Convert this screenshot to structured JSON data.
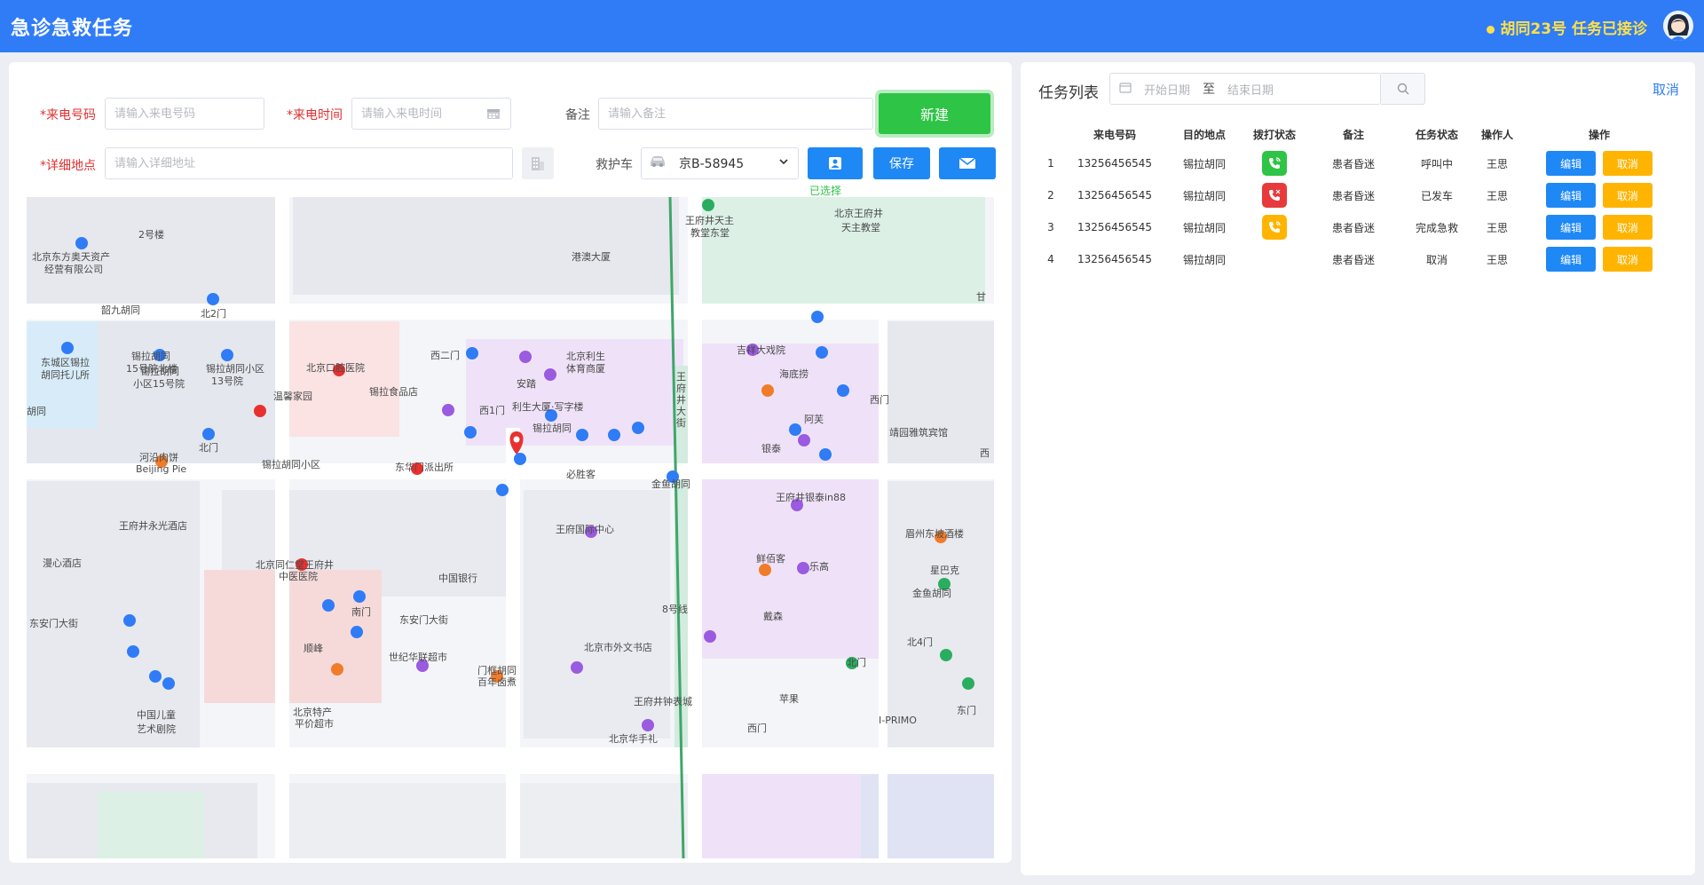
{
  "header": {
    "title": "急诊急救任务",
    "status": "胡同23号 任务已接诊"
  },
  "form": {
    "phone_label": "来电号码",
    "phone_placeholder": "请输入来电号码",
    "time_label": "来电时间",
    "time_placeholder": "请输入来电时间",
    "remark_label": "备注",
    "remark_placeholder": "请输入备注",
    "new_button": "新建",
    "address_label": "详细地点",
    "address_placeholder": "请输入详细地址",
    "ambulance_label": "救护车",
    "ambulance_value": "京B-58945",
    "save_button": "保存",
    "selected_hint": "已选择",
    "required_mark": "*"
  },
  "map": {
    "labels": {
      "l1": "2号楼",
      "l2": "北京东方奥天资产",
      "l3": "经营有限公司",
      "l4": "韶九胡同",
      "l5": "北2门",
      "l6": "锡拉胡同",
      "l7": "15号院北楼",
      "l8": "东城区锡拉",
      "l9": "胡同托儿所",
      "l10": "锡拉胡同",
      "l11": "小区15号院",
      "l12": "锡拉胡同小区",
      "l13": "13号院",
      "l14": "北京口腔医院",
      "l15": "温馨家园",
      "l16": "西二门",
      "l17": "安踏",
      "l18": "北京利生",
      "l19": "体育商厦",
      "l20": "锡拉食品店",
      "l21": "利生大厦·写字楼",
      "l22": "西1门",
      "l23": "胡同",
      "l24": "锡拉胡同",
      "l25": "王府井天主",
      "l26": "教堂东堂",
      "l27": "北京王府井",
      "l28": "天主教堂",
      "l29": "港澳大厦",
      "l30": "甘",
      "l31": "吉祥大戏院",
      "l32": "海底捞",
      "l33": "西门",
      "l34": "阿芙",
      "l35": "靖园雅筑宾馆",
      "l36": "银泰",
      "l37": "西",
      "l38": "王府井银泰in88",
      "l39": "眉州东坡酒楼",
      "l40": "星巴克",
      "l41": "鲜佰客",
      "l42": "乐高",
      "l43": "河沿肉饼",
      "l44": "Beijing Pie",
      "l45": "北门",
      "l46": "锡拉胡同小区",
      "l47": "东华门派出所",
      "l48": "必胜客",
      "l49": "王府国际中心",
      "l50": "金鱼胡同",
      "l51": "王府井永光酒店",
      "l52": "漫心酒店",
      "l53": "北京同仁堂王府井",
      "l54": "中医医院",
      "l55": "中国银行",
      "l56": "南门",
      "l57": "东安门大街",
      "l58": "东安门大街",
      "l59": "金鱼胡同",
      "l60": "戴森",
      "l61": "北4门",
      "l62": "北门",
      "l63": "苹果",
      "l64": "I-PRIMO",
      "l65": "东门",
      "l66": "西门",
      "l67": "顺峰",
      "l68": "世纪华联超市",
      "l69": "北京市外文书店",
      "l70": "门框胡同",
      "l71": "百年卤煮",
      "l72": "王府井钟表城",
      "l73": "北京特产",
      "l74": "平价超市",
      "l75": "中国儿童",
      "l76": "艺术剧院",
      "l77": "北京华手礼",
      "l78": "王",
      "l79": "府",
      "l80": "井",
      "l81": "大",
      "l82": "街",
      "l83": "8号线"
    }
  },
  "task_list": {
    "title": "任务列表",
    "start_placeholder": "开始日期",
    "separator": "至",
    "end_placeholder": "结束日期",
    "cancel": "取消",
    "columns": [
      "",
      "来电号码",
      "目的地点",
      "拨打状态",
      "备注",
      "任务状态",
      "操作人",
      "操作"
    ],
    "rows": [
      {
        "index": "1",
        "phone": "13256456545",
        "dest": "锡拉胡同",
        "call": "green",
        "remark": "患者昏迷",
        "status": "呼叫中",
        "operator": "王思",
        "edit": "编辑",
        "cancel": "取消"
      },
      {
        "index": "2",
        "phone": "13256456545",
        "dest": "锡拉胡同",
        "call": "red",
        "remark": "患者昏迷",
        "status": "已发车",
        "operator": "王思",
        "edit": "编辑",
        "cancel": "取消"
      },
      {
        "index": "3",
        "phone": "13256456545",
        "dest": "锡拉胡同",
        "call": "yellow",
        "remark": "患者昏迷",
        "status": "完成急救",
        "operator": "王思",
        "edit": "编辑",
        "cancel": "取消"
      },
      {
        "index": "4",
        "phone": "13256456545",
        "dest": "锡拉胡同",
        "call": "",
        "remark": "患者昏迷",
        "status": "取消",
        "operator": "王思",
        "edit": "编辑",
        "cancel": "取消"
      }
    ]
  },
  "colors": {
    "header": "#2f7cf6",
    "green": "#2ec445",
    "blue": "#1e88f5",
    "orange": "#ffb400",
    "red": "#e83a3a"
  }
}
